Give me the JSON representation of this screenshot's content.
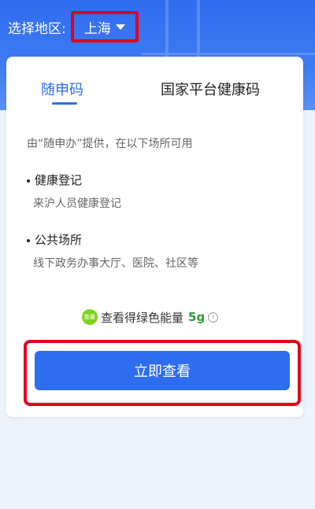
{
  "region": {
    "label": "选择地区:",
    "selected": "上海"
  },
  "tabs": [
    {
      "label": "随申码",
      "active": true
    },
    {
      "label": "国家平台健康码",
      "active": false
    }
  ],
  "description": "由“随申办”提供，在以下场所可用",
  "sections": [
    {
      "title": "健康登记",
      "subtitle": "来沪人员健康登记"
    },
    {
      "title": "公共场所",
      "subtitle": "线下政务办事大厅、医院、社区等"
    }
  ],
  "energy": {
    "icon_text": "能量",
    "text": "查看得绿色能量",
    "value": "5g"
  },
  "cta": {
    "label": "立即查看"
  },
  "colors": {
    "primary": "#2f6df0",
    "highlight": "#e3001b",
    "energy_green": "#2e9b3a"
  }
}
